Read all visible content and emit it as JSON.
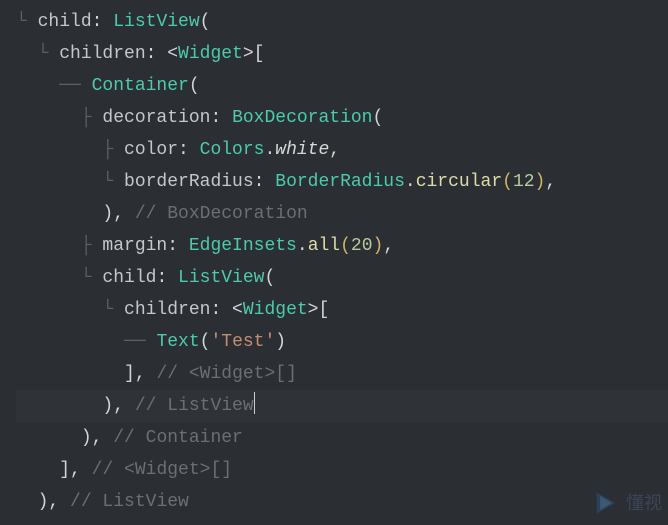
{
  "watermark_text": "懂视",
  "code_lines": [
    {
      "indent": 1,
      "tree": "L",
      "segments": [
        {
          "t": "child",
          "c": "c-key"
        },
        {
          "t": ": ",
          "c": "c-punc"
        },
        {
          "t": "ListView",
          "c": "c-type"
        },
        {
          "t": "(",
          "c": "c-punc"
        }
      ]
    },
    {
      "indent": 2,
      "tree": "corner",
      "segments": [
        {
          "t": "children",
          "c": "c-key"
        },
        {
          "t": ": <",
          "c": "c-punc"
        },
        {
          "t": "Widget",
          "c": "c-type"
        },
        {
          "t": ">[",
          "c": "c-punc"
        }
      ]
    },
    {
      "indent": 3,
      "tree": "dash",
      "segments": [
        {
          "t": "Container",
          "c": "c-type"
        },
        {
          "t": "(",
          "c": "c-punc"
        }
      ]
    },
    {
      "indent": 4,
      "tree": "T",
      "segments": [
        {
          "t": "decoration",
          "c": "c-key"
        },
        {
          "t": ": ",
          "c": "c-punc"
        },
        {
          "t": "BoxDecoration",
          "c": "c-type"
        },
        {
          "t": "(",
          "c": "c-punc"
        }
      ]
    },
    {
      "indent": 5,
      "tree": "T",
      "segments": [
        {
          "t": "color",
          "c": "c-key"
        },
        {
          "t": ": ",
          "c": "c-punc"
        },
        {
          "t": "Colors",
          "c": "c-type"
        },
        {
          "t": ".",
          "c": "c-punc"
        },
        {
          "t": "white",
          "c": "c-prop"
        },
        {
          "t": ",",
          "c": "c-punc"
        }
      ]
    },
    {
      "indent": 5,
      "tree": "corner",
      "segments": [
        {
          "t": "borderRadius",
          "c": "c-key"
        },
        {
          "t": ": ",
          "c": "c-punc"
        },
        {
          "t": "BorderRadius",
          "c": "c-type"
        },
        {
          "t": ".",
          "c": "c-punc"
        },
        {
          "t": "circular",
          "c": "c-func"
        },
        {
          "t": "(",
          "c": "c-punc2"
        },
        {
          "t": "12",
          "c": "c-num"
        },
        {
          "t": ")",
          "c": "c-punc2"
        },
        {
          "t": ",",
          "c": "c-punc"
        }
      ]
    },
    {
      "indent": 4,
      "tree": "",
      "segments": [
        {
          "t": ")",
          "c": "c-punc"
        },
        {
          "t": ", ",
          "c": "c-punc"
        },
        {
          "t": "// BoxDecoration",
          "c": "c-comment"
        }
      ]
    },
    {
      "indent": 4,
      "tree": "T",
      "segments": [
        {
          "t": "margin",
          "c": "c-key"
        },
        {
          "t": ": ",
          "c": "c-punc"
        },
        {
          "t": "EdgeInsets",
          "c": "c-type"
        },
        {
          "t": ".",
          "c": "c-punc"
        },
        {
          "t": "all",
          "c": "c-func"
        },
        {
          "t": "(",
          "c": "c-punc2"
        },
        {
          "t": "20",
          "c": "c-num"
        },
        {
          "t": ")",
          "c": "c-punc2"
        },
        {
          "t": ",",
          "c": "c-punc"
        }
      ]
    },
    {
      "indent": 4,
      "tree": "corner",
      "segments": [
        {
          "t": "child",
          "c": "c-key"
        },
        {
          "t": ": ",
          "c": "c-punc"
        },
        {
          "t": "ListView",
          "c": "c-type"
        },
        {
          "t": "(",
          "c": "c-punc"
        }
      ]
    },
    {
      "indent": 5,
      "tree": "corner",
      "segments": [
        {
          "t": "children",
          "c": "c-key"
        },
        {
          "t": ": <",
          "c": "c-punc"
        },
        {
          "t": "Widget",
          "c": "c-type"
        },
        {
          "t": ">[",
          "c": "c-punc"
        }
      ]
    },
    {
      "indent": 6,
      "tree": "dash",
      "segments": [
        {
          "t": "Text",
          "c": "c-type"
        },
        {
          "t": "(",
          "c": "c-punc"
        },
        {
          "t": "'Test'",
          "c": "c-str"
        },
        {
          "t": ")",
          "c": "c-punc"
        }
      ]
    },
    {
      "indent": 5,
      "tree": "",
      "segments": [
        {
          "t": "]",
          "c": "c-punc"
        },
        {
          "t": ", ",
          "c": "c-punc"
        },
        {
          "t": "// <Widget>[]",
          "c": "c-comment"
        }
      ]
    },
    {
      "indent": 4,
      "tree": "",
      "highlight": true,
      "cursor": true,
      "segments": [
        {
          "t": ")",
          "c": "c-punc"
        },
        {
          "t": ", ",
          "c": "c-punc"
        },
        {
          "t": "// ListView",
          "c": "c-comment"
        }
      ]
    },
    {
      "indent": 3,
      "tree": "",
      "segments": [
        {
          "t": ")",
          "c": "c-punc"
        },
        {
          "t": ", ",
          "c": "c-punc"
        },
        {
          "t": "// Container",
          "c": "c-comment"
        }
      ]
    },
    {
      "indent": 2,
      "tree": "",
      "segments": [
        {
          "t": "]",
          "c": "c-punc"
        },
        {
          "t": ", ",
          "c": "c-punc"
        },
        {
          "t": "// <Widget>[]",
          "c": "c-comment"
        }
      ]
    },
    {
      "indent": 1,
      "tree": "",
      "segments": [
        {
          "t": ")",
          "c": "c-punc"
        },
        {
          "t": ", ",
          "c": "c-punc"
        },
        {
          "t": "// ListView",
          "c": "c-comment"
        }
      ]
    }
  ]
}
